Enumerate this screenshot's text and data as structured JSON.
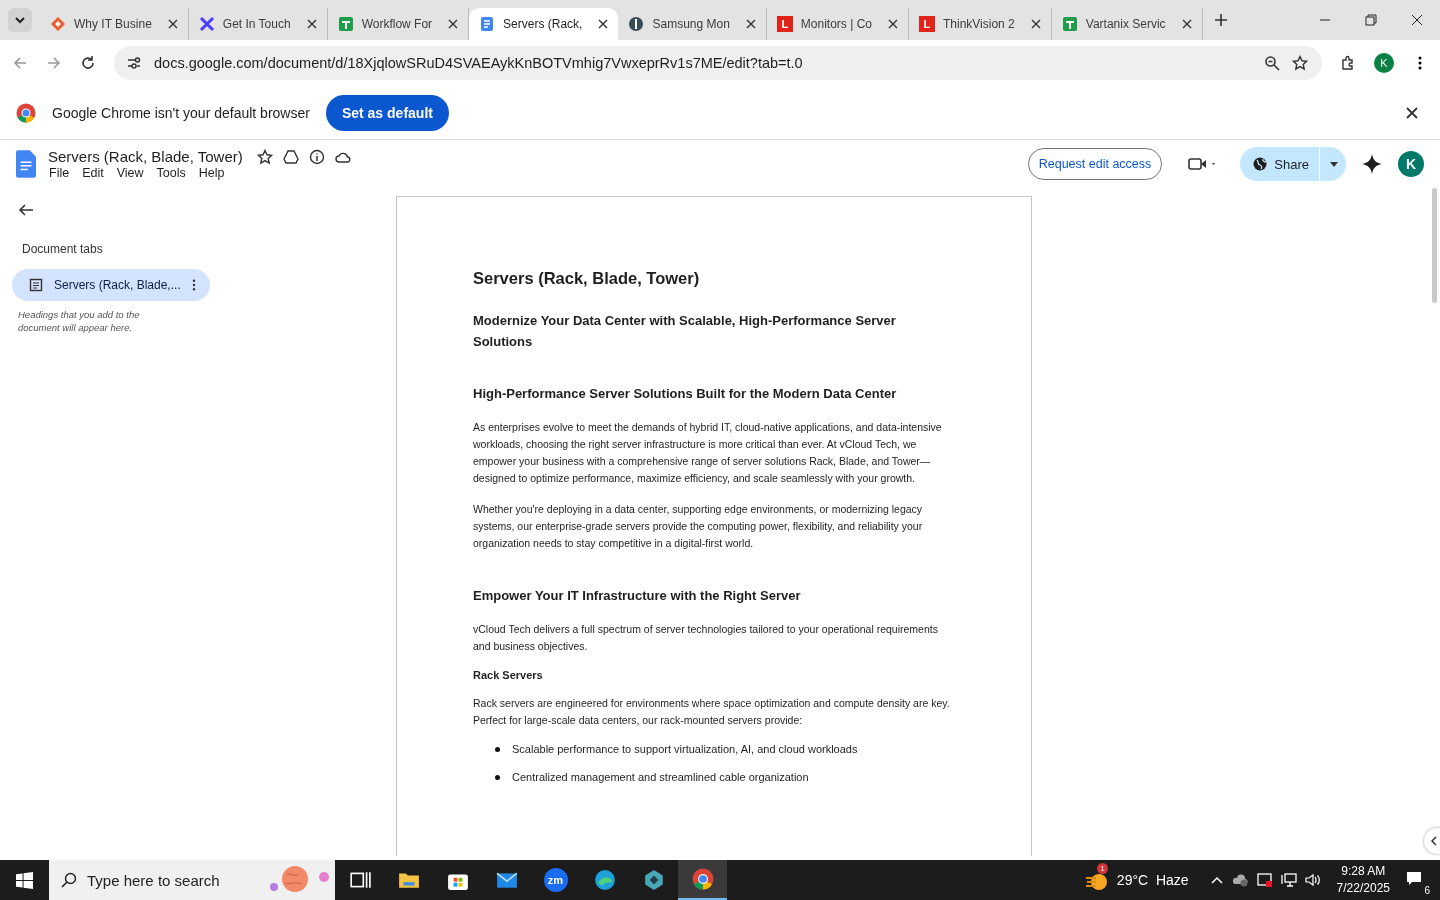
{
  "browser": {
    "tabs": [
      {
        "title": "Why IT Busine",
        "kind": "diamond",
        "selected": false
      },
      {
        "title": "Get In Touch",
        "kind": "cross",
        "selected": false
      },
      {
        "title": "Workflow For",
        "kind": "sheet",
        "selected": false
      },
      {
        "title": "Servers (Rack,",
        "kind": "doc",
        "selected": true
      },
      {
        "title": "Samsung Mon",
        "kind": "circle",
        "selected": false
      },
      {
        "title": "Monitors | Co",
        "kind": "letter",
        "logo_letter": "L",
        "selected": false
      },
      {
        "title": "ThinkVision 2",
        "kind": "letter",
        "logo_letter": "L",
        "selected": false
      },
      {
        "title": "Vartanix Servic",
        "kind": "sheet",
        "selected": false
      }
    ],
    "url": "docs.google.com/document/d/18XjqlowSRuD4SVAEAykKnBOTVmhig7VwxeprRv1s7ME/edit?tab=t.0",
    "profile_initial": "K",
    "infobar": {
      "message": "Google Chrome isn't your default browser",
      "button": "Set as default"
    }
  },
  "docs": {
    "title": "Servers (Rack, Blade, Tower)",
    "menu": [
      "File",
      "Edit",
      "View",
      "Tools",
      "Help"
    ],
    "request_button": "Request edit access",
    "share_button": "Share",
    "avatar": "K",
    "sidebar": {
      "heading": "Document tabs",
      "tabs": [
        {
          "label": "Servers (Rack, Blade,...",
          "selected": true
        }
      ],
      "hint": "Headings that you add to the document will appear here."
    },
    "content": [
      {
        "kind": "title",
        "text": "Servers (Rack, Blade, Tower)"
      },
      {
        "kind": "subtitle",
        "text": "Modernize Your Data Center with Scalable, High-Performance Server Solutions"
      },
      {
        "kind": "h2",
        "text": "High-Performance Server Solutions Built for the Modern Data Center"
      },
      {
        "kind": "p",
        "text": "As enterprises evolve to meet the demands of hybrid IT, cloud-native applications, and data-intensive workloads, choosing the right server infrastructure is more critical than ever. At vCloud Tech, we empower your business with a comprehensive range of server solutions Rack, Blade, and Tower—designed to optimize performance, maximize efficiency, and scale seamlessly with your growth."
      },
      {
        "kind": "p",
        "text": "Whether you're deploying in a data center, supporting edge environments, or modernizing legacy systems, our enterprise-grade servers provide the computing power, flexibility, and reliability your organization needs to stay competitive in a digital-first world."
      },
      {
        "kind": "h2",
        "text": "Empower Your IT Infrastructure with the Right Server"
      },
      {
        "kind": "p",
        "text": "vCloud Tech delivers a full spectrum of server technologies tailored to your operational requirements and business objectives."
      },
      {
        "kind": "h3",
        "text": "Rack Servers"
      },
      {
        "kind": "p",
        "text": "Rack servers are engineered for environments where space optimization and compute density are key. Perfect for large-scale data centers, our rack-mounted servers provide:"
      },
      {
        "kind": "bullet",
        "text": "Scalable performance to support virtualization, AI, and cloud workloads"
      },
      {
        "kind": "bullet",
        "text": "Centralized management and streamlined cable organization"
      }
    ]
  },
  "taskbar": {
    "search_placeholder": "Type here to search",
    "apps": [
      {
        "kind": "taskview",
        "selected": false
      },
      {
        "kind": "folder",
        "selected": false
      },
      {
        "kind": "store",
        "selected": false
      },
      {
        "kind": "mail",
        "selected": false
      },
      {
        "kind": "zoom",
        "label": "zm",
        "selected": false
      },
      {
        "kind": "edge",
        "selected": false
      },
      {
        "kind": "cube",
        "selected": false
      },
      {
        "kind": "chrome",
        "selected": true
      }
    ],
    "weather_badge": "1",
    "weather": "29°C  Haze",
    "time": "9:28 AM",
    "date": "7/22/2025",
    "notifications": "6"
  }
}
